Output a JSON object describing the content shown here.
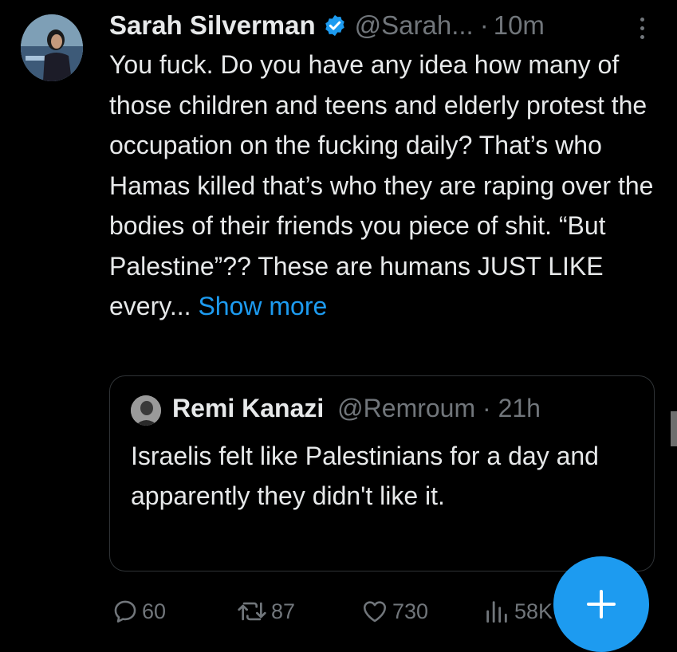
{
  "tweet": {
    "author_name": "Sarah Silverman",
    "handle": "@Sarah...",
    "separator": "·",
    "time": "10m",
    "text": "You fuck. Do you have any idea how many of those children and teens and elderly protest the occupation on the fucking daily? That’s who Hamas killed that’s who they are raping over the bodies of their friends you piece of shit. “But Palestine”?? These are humans JUST LIKE every...",
    "show_more": "Show more"
  },
  "quote": {
    "author_name": "Remi Kanazi",
    "handle": "@Remroum",
    "separator": "·",
    "time": "21h",
    "text": "Israelis felt like Palestinians for a day and apparently they didn't like it."
  },
  "actions": {
    "replies": "60",
    "retweets": "87",
    "likes": "730",
    "views": "58K"
  },
  "icons": {
    "verified": "verified-badge-icon",
    "more": "more-vertical-icon",
    "reply": "reply-icon",
    "retweet": "retweet-icon",
    "like": "heart-icon",
    "views": "views-icon",
    "compose": "plus-icon"
  },
  "colors": {
    "background": "#000000",
    "text": "#e7e9ea",
    "secondary": "#71767b",
    "accent": "#1d9bf0",
    "border": "#2f3336"
  }
}
